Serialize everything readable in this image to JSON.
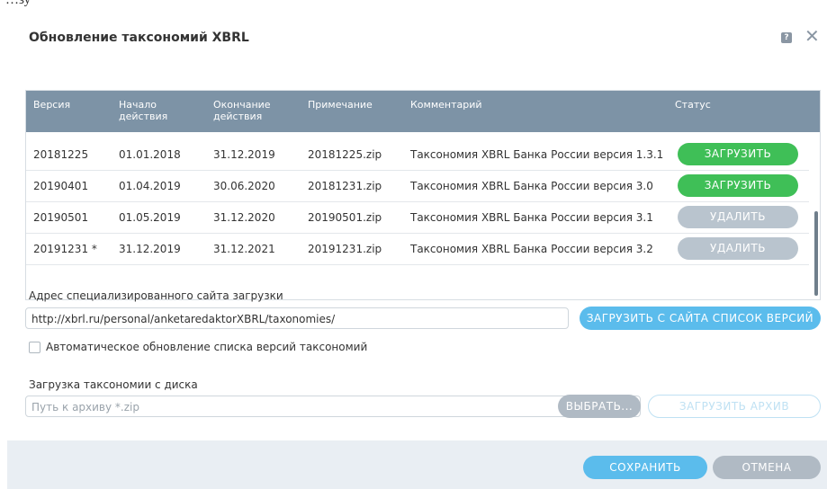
{
  "top_cutoff_text": "…зу",
  "dialog": {
    "title": "Обновление таксономий XBRL",
    "help_glyph": "?",
    "close_glyph": "✕"
  },
  "table": {
    "headers": {
      "version": "Версия",
      "start": "Начало действия",
      "end": "Окончание действия",
      "note": "Примечание",
      "comment": "Комментарий",
      "status": "Статус"
    },
    "rows": [
      {
        "version": "20181225",
        "start": "01.01.2018",
        "end": "31.12.2019",
        "note": "20181225.zip",
        "comment": "Таксономия XBRL Банка России версия 1.3.1 с ...",
        "status": "ЗАГРУЗИТЬ",
        "status_kind": "load"
      },
      {
        "version": "20190401",
        "start": "01.04.2019",
        "end": "30.06.2020",
        "note": "20181231.zip",
        "comment": "Таксономия XBRL Банка России версия 3.0",
        "status": "ЗАГРУЗИТЬ",
        "status_kind": "load"
      },
      {
        "version": "20190501",
        "start": "01.05.2019",
        "end": "31.12.2020",
        "note": "20190501.zip",
        "comment": "Таксономия XBRL Банка России версия 3.1",
        "status": "УДАЛИТЬ",
        "status_kind": "delete"
      },
      {
        "version": "20191231 *",
        "start": "31.12.2019",
        "end": "31.12.2021",
        "note": "20191231.zip",
        "comment": "Таксономия XBRL Банка России версия 3.2",
        "status": "УДАЛИТЬ",
        "status_kind": "delete"
      }
    ]
  },
  "site": {
    "label": "Адрес специализированного сайта загрузки",
    "url": "http://xbrl.ru/personal/anketaredaktorXBRL/taxonomies/",
    "load_list_button": "ЗАГРУЗИТЬ С САЙТА СПИСОК ВЕРСИЙ",
    "auto_update_label": "Автоматическое обновление списка версий таксономий",
    "auto_update_checked": false
  },
  "disk": {
    "label": "Загрузка таксономии с диска",
    "placeholder": "Путь к архиву *.zip",
    "choose_button": "ВЫБРАТЬ...",
    "upload_button": "ЗАГРУЗИТЬ АРХИВ"
  },
  "footer": {
    "save_button": "СОХРАНИТЬ",
    "cancel_button": "ОТМЕНА"
  },
  "colors": {
    "header": "#7d93a6",
    "load": "#3fbf57",
    "delete": "#b9c4ce",
    "primary": "#5bbcec",
    "disabled_outline": "#bfe1f3",
    "gray_button": "#b0bac4"
  }
}
